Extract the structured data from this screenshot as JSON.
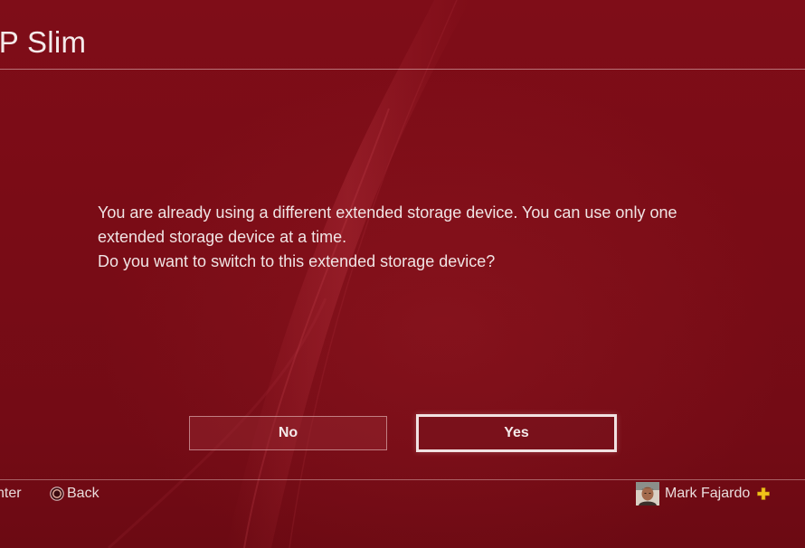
{
  "header": {
    "title": "JP Slim"
  },
  "dialog": {
    "lines": [
      "You are already using a different extended storage device. You can use only one",
      "extended storage device at a time.",
      "Do you want to switch to this extended storage device?"
    ],
    "no_label": "No",
    "yes_label": "Yes"
  },
  "footer": {
    "enter_label": "nter",
    "back_label": "Back",
    "back_icon": "circle-button-icon",
    "user_name": "Mark Fajardo",
    "plus_icon": "playstation-plus-icon"
  },
  "colors": {
    "background": "#7a0d17",
    "text": "#f1e6e6",
    "plus_gold": "#f2c21a"
  }
}
